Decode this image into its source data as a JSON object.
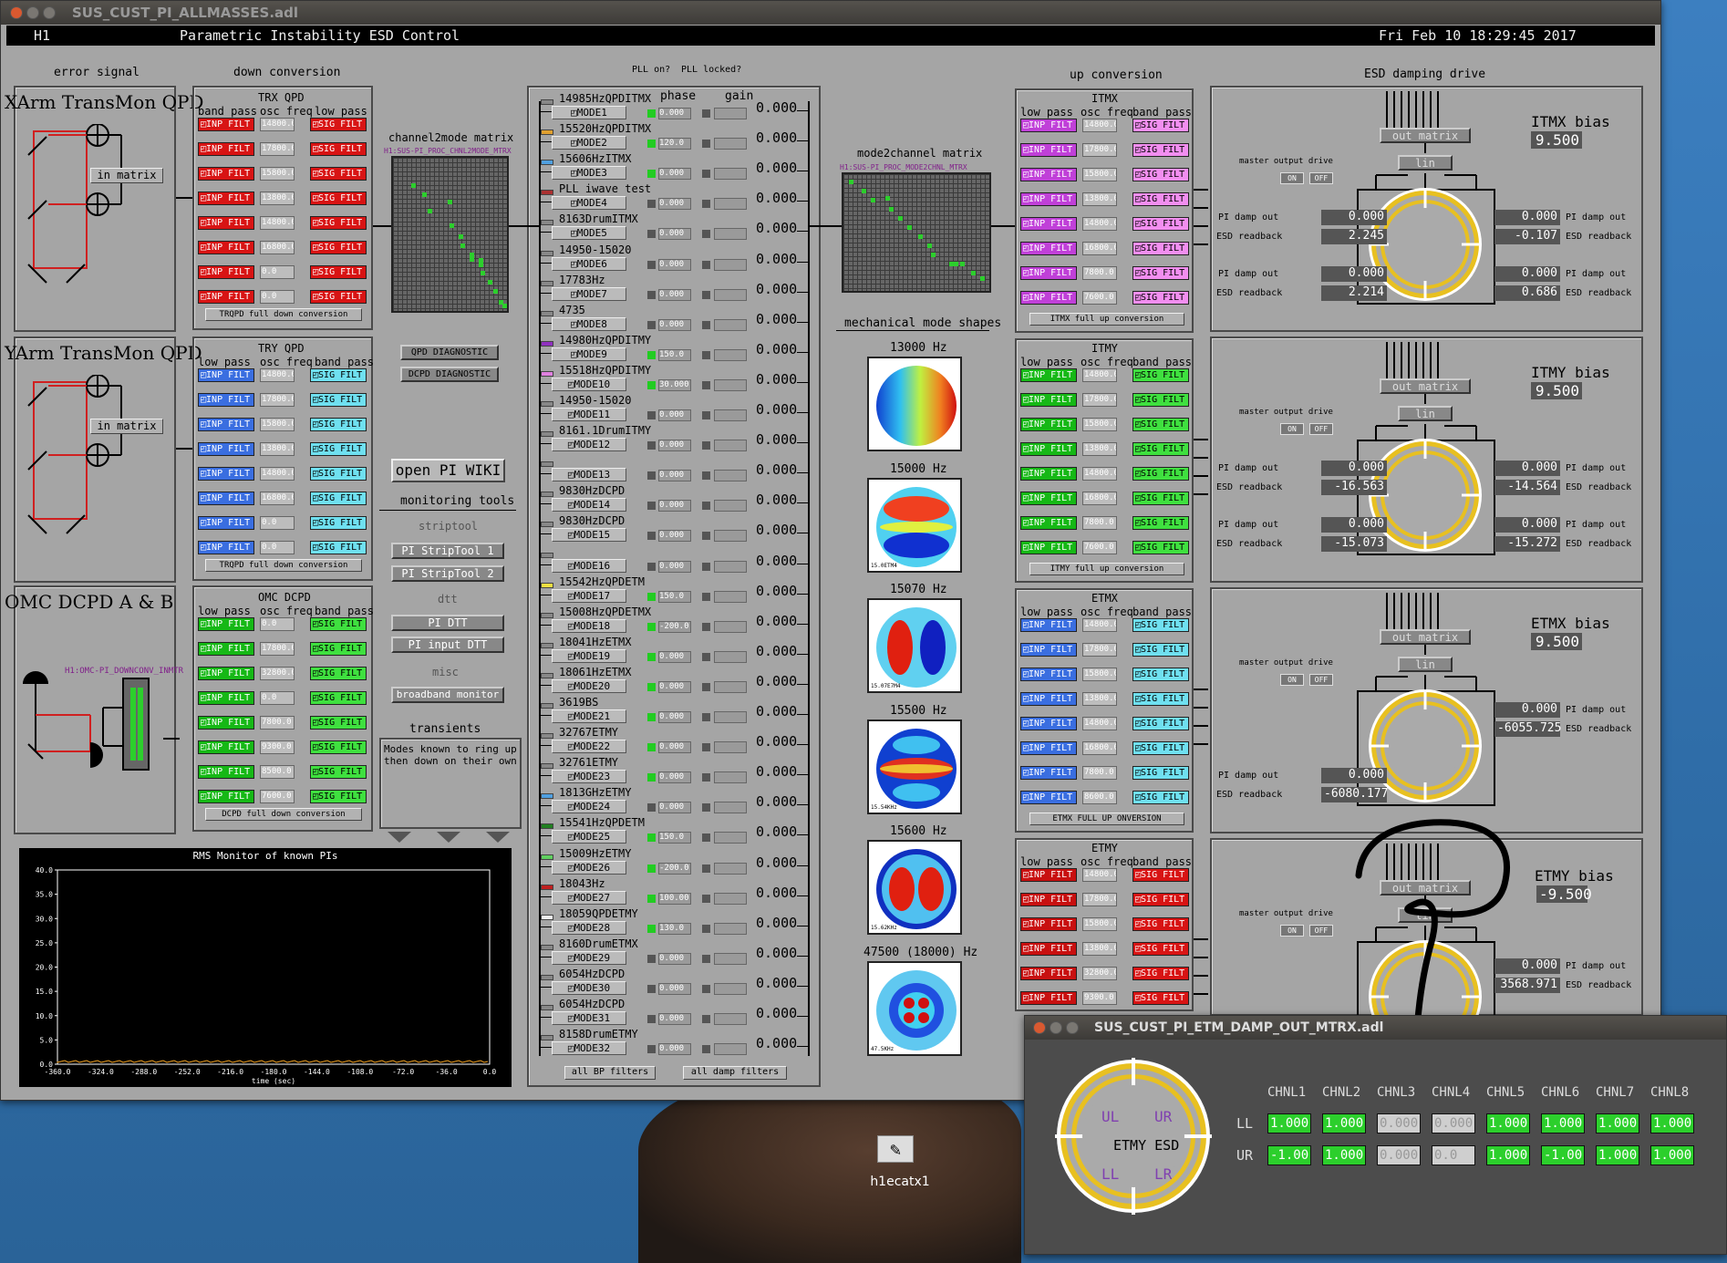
{
  "main_window": {
    "title": "SUS_CUST_PI_ALLMASSES.adl",
    "site": "H1",
    "screen_title": "Parametric Instability ESD Control",
    "datetime": "Fri Feb 10 18:29:45 2017"
  },
  "sections": {
    "error_signal": "error signal",
    "down_conversion": "down conversion",
    "up_conversion": "up conversion",
    "esd_damping": "ESD damping drive",
    "pll_on": "PLL on?",
    "pll_locked": "PLL locked?",
    "phase": "phase",
    "gain": "gain"
  },
  "error_panels": [
    {
      "title": "XArm TransMon QPD"
    },
    {
      "title": "YArm TransMon QPD"
    },
    {
      "title": "OMC DCPD A & B"
    }
  ],
  "in_matrix": "in matrix",
  "omc_channel": "H1:OMC-PI_DOWNCONV_INMTR",
  "headers": {
    "band_pass": "band pass",
    "low_pass": "low pass",
    "osc_freq": "osc freq",
    "inp_filt": "INP FILT",
    "sig_filt": "SIG FILT"
  },
  "down_panels": [
    {
      "title": "TRX QPD",
      "freqs": [
        "14800.0",
        "17800.0",
        "15800.0",
        "13800.0",
        "14800.0",
        "16800.0",
        "0.0",
        "0.0"
      ],
      "full": "TRQPD full down conversion"
    },
    {
      "title": "TRY QPD",
      "freqs": [
        "14800.0",
        "17800.0",
        "15800.0",
        "13800.0",
        "14800.0",
        "16800.0",
        "0.0",
        "0.0"
      ],
      "full": "TRQPD full down conversion"
    },
    {
      "title": "OMC DCPD",
      "freqs": [
        "0.0",
        "17800.0",
        "32800.0",
        "0.0",
        "7800.0",
        "9300.0",
        "8500.0",
        "7600.0"
      ],
      "full": "DCPD full down conversion"
    }
  ],
  "c2m": {
    "title": "channel2mode matrix",
    "channel": "H1:SUS-PI_PROC_CHNL2MODE_MTRX"
  },
  "m2c": {
    "title": "mode2channel matrix",
    "channel": "H1:SUS-PI_PROC_MODE2CHNL_MTRX"
  },
  "diag": {
    "qpd": "QPD DIAGNOSTIC",
    "dcpd": "DCPD DIAGNOSTIC"
  },
  "wiki": "open PI WIKI",
  "monitoring": {
    "title": "monitoring tools",
    "striptool": "striptool",
    "st1": "PI StripTool 1",
    "st2": "PI StripTool 2",
    "dtt": "dtt",
    "pi_dtt": "PI DTT",
    "pi_input_dtt": "PI input DTT",
    "misc": "misc",
    "broadband": "broadband monitor",
    "transients": "transients",
    "transients_text": "Modes known to ring up then down on their own"
  },
  "rms": {
    "title": "RMS Monitor of known PIs",
    "yticks": [
      "40.0",
      "35.0",
      "30.0",
      "25.0",
      "20.0",
      "15.0",
      "10.0",
      "5.0",
      "0.0"
    ],
    "xticks": [
      "-360.0",
      "-324.0",
      "-288.0",
      "-252.0",
      "-216.0",
      "-180.0",
      "-144.0",
      "-108.0",
      "-72.0",
      "-36.0",
      "0.0"
    ],
    "xlabel": "time (sec)"
  },
  "modes": [
    {
      "label": "14985HzQPDITMX",
      "name": "MODE1",
      "pll": true,
      "phase": "0.000",
      "gain": "0.000",
      "color": "#888888"
    },
    {
      "label": "15520HzQPDITMX",
      "name": "MODE2",
      "pll": true,
      "phase": "120.0",
      "gain": "0.000",
      "color": "#e0a030"
    },
    {
      "label": "15606HzITMX",
      "name": "MODE3",
      "pll": true,
      "phase": "0.000",
      "gain": "0.000",
      "color": "#50a0e0"
    },
    {
      "label": "PLL iwave test",
      "name": "MODE4",
      "pll": false,
      "phase": "0.000",
      "gain": "0.000",
      "color": "#aa3030"
    },
    {
      "label": "8163DrumITMX",
      "name": "MODE5",
      "pll": false,
      "phase": "0.000",
      "gain": "0.000",
      "color": "#888888"
    },
    {
      "label": "14950-15020",
      "name": "MODE6",
      "pll": false,
      "phase": "0.000",
      "gain": "0.000",
      "color": "#888888"
    },
    {
      "label": "17783Hz",
      "name": "MODE7",
      "pll": false,
      "phase": "0.000",
      "gain": "0.000",
      "color": "#888888"
    },
    {
      "label": "4735",
      "name": "MODE8",
      "pll": false,
      "phase": "0.000",
      "gain": "0.000",
      "color": "#888888"
    },
    {
      "label": "14980HzQPDITMY",
      "name": "MODE9",
      "pll": true,
      "phase": "150.0",
      "gain": "0.000",
      "color": "#9030c0"
    },
    {
      "label": "15518HzQPDITMY",
      "name": "MODE10",
      "pll": true,
      "phase": "30.000",
      "gain": "0.000",
      "color": "#e080e0"
    },
    {
      "label": "14950-15020",
      "name": "MODE11",
      "pll": false,
      "phase": "0.000",
      "gain": "0.000",
      "color": "#888888"
    },
    {
      "label": "8161.1DrumITMY",
      "name": "MODE12",
      "pll": false,
      "phase": "0.000",
      "gain": "0.000",
      "color": "#888888"
    },
    {
      "label": "",
      "name": "MODE13",
      "pll": false,
      "phase": "0.000",
      "gain": "0.000",
      "color": "#888888"
    },
    {
      "label": "9830HzDCPD",
      "name": "MODE14",
      "pll": false,
      "phase": "0.000",
      "gain": "0.000",
      "color": "#888888"
    },
    {
      "label": "9830HzDCPD",
      "name": "MODE15",
      "pll": false,
      "phase": "0.000",
      "gain": "0.000",
      "color": "#888888"
    },
    {
      "label": "",
      "name": "MODE16",
      "pll": false,
      "phase": "0.000",
      "gain": "0.000",
      "color": "#888888"
    },
    {
      "label": "15542HzQPDETM",
      "name": "MODE17",
      "pll": true,
      "phase": "150.0",
      "gain": "0.000",
      "color": "#f0e040"
    },
    {
      "label": "15008HzQPDETMX",
      "name": "MODE18",
      "pll": true,
      "phase": "-200.0",
      "gain": "0.000",
      "color": "#888888"
    },
    {
      "label": "18041HzETMX",
      "name": "MODE19",
      "pll": true,
      "phase": "0.000",
      "gain": "0.000",
      "color": "#888888"
    },
    {
      "label": "18061HzETMX",
      "name": "MODE20",
      "pll": true,
      "phase": "0.000",
      "gain": "0.000",
      "color": "#888888"
    },
    {
      "label": "3619BS",
      "name": "MODE21",
      "pll": true,
      "phase": "0.000",
      "gain": "0.000",
      "color": "#888888"
    },
    {
      "label": "32767ETMY",
      "name": "MODE22",
      "pll": true,
      "phase": "0.000",
      "gain": "0.000",
      "color": "#888888"
    },
    {
      "label": "32761ETMY",
      "name": "MODE23",
      "pll": true,
      "phase": "0.000",
      "gain": "0.000",
      "color": "#888888"
    },
    {
      "label": "1813GHzETMY",
      "name": "MODE24",
      "pll": false,
      "phase": "0.000",
      "gain": "0.000",
      "color": "#50a0e0"
    },
    {
      "label": "15541HzQPDETM",
      "name": "MODE25",
      "pll": true,
      "phase": "150.0",
      "gain": "0.000",
      "color": "#208020"
    },
    {
      "label": "15009HzETMY",
      "name": "MODE26",
      "pll": true,
      "phase": "-200.0",
      "gain": "0.000",
      "color": "#60d060"
    },
    {
      "label": "18043Hz",
      "name": "MODE27",
      "pll": true,
      "phase": "100.00",
      "gain": "0.000",
      "color": "#c02020"
    },
    {
      "label": "18059QPDETMY",
      "name": "MODE28",
      "pll": true,
      "phase": "130.0",
      "gain": "0.000",
      "color": "#f0f0f0"
    },
    {
      "label": "8160DrumETMX",
      "name": "MODE29",
      "pll": false,
      "phase": "0.000",
      "gain": "0.000",
      "color": "#888888"
    },
    {
      "label": "6054HzDCPD",
      "name": "MODE30",
      "pll": false,
      "phase": "0.000",
      "gain": "0.000",
      "color": "#888888"
    },
    {
      "label": "6054HzDCPD",
      "name": "MODE31",
      "pll": false,
      "phase": "0.000",
      "gain": "0.000",
      "color": "#888888"
    },
    {
      "label": "8158DrumETMY",
      "name": "MODE32",
      "pll": false,
      "phase": "0.000",
      "gain": "0.000",
      "color": "#888888"
    }
  ],
  "all_bp": "all BP filters",
  "all_damp": "all damp filters",
  "shapes": {
    "title": "mechanical mode shapes",
    "items": [
      {
        "freq": "13000 Hz",
        "cap": ""
      },
      {
        "freq": "15000 Hz",
        "cap": "15.0ETM4"
      },
      {
        "freq": "15070 Hz",
        "cap": "15.07E7M4"
      },
      {
        "freq": "15500 Hz",
        "cap": "15.54KHz"
      },
      {
        "freq": "15600 Hz",
        "cap": "15.62KHz"
      },
      {
        "freq": "47500 (18000) Hz",
        "cap": "47.5KHz"
      }
    ]
  },
  "up_panels": [
    {
      "title": "ITMX",
      "freqs": [
        "14800.0",
        "17800.0",
        "15800.0",
        "13800.0",
        "14800.0",
        "16800.0",
        "7800.0",
        "7600.0"
      ],
      "full": "ITMX full up conversion"
    },
    {
      "title": "ITMY",
      "freqs": [
        "14800.0",
        "17800.0",
        "15800.0",
        "13800.0",
        "14800.0",
        "16800.0",
        "7800.0",
        "7600.0"
      ],
      "full": "ITMY full up conversion"
    },
    {
      "title": "ETMX",
      "freqs": [
        "14800.0",
        "17800.0",
        "15800.0",
        "13800.0",
        "14800.0",
        "16800.0",
        "7800.0",
        "8600.0"
      ],
      "full": "ETMX FULL UP ONVERSION"
    },
    {
      "title": "ETMY",
      "freqs": [
        "14800.0",
        "17800.0",
        "15800.0",
        "13800.0",
        "32800.0",
        "9300.0"
      ],
      "full": ""
    }
  ],
  "esd": {
    "out_matrix": "out matrix",
    "lin": "lin",
    "master": "master output drive",
    "on": "ON",
    "off": "OFF",
    "pi_damp_out": "PI damp out",
    "esd_readback": "ESD readback",
    "panels": [
      {
        "bias_label": "ITMX bias",
        "bias": "9.500",
        "l1": "0.000",
        "l2": "2.245",
        "l3": "0.000",
        "l4": "2.214",
        "r1": "0.000",
        "r2": "-0.107",
        "r3": "0.000",
        "r4": "0.686"
      },
      {
        "bias_label": "ITMY bias",
        "bias": "9.500",
        "l1": "0.000",
        "l2": "-16.563",
        "l3": "0.000",
        "l4": "-15.073",
        "r1": "0.000",
        "r2": "-14.564",
        "r3": "0.000",
        "r4": "-15.272"
      },
      {
        "bias_label": "ETMX bias",
        "bias": "9.500",
        "l3": "0.000",
        "l4": "-6080.177",
        "r1": "0.000",
        "r2": "-6055.725"
      },
      {
        "bias_label": "ETMY bias",
        "bias": "-9.500",
        "r1": "0.000",
        "r2": "3568.971"
      }
    ]
  },
  "popup": {
    "title": "SUS_CUST_PI_ETM_DAMP_OUT_MTRX.adl",
    "esd_label": "ETMY ESD",
    "quad": {
      "ul": "UL",
      "ur": "UR",
      "ll": "LL",
      "lr": "LR"
    },
    "cols": [
      "CHNL1",
      "CHNL2",
      "CHNL3",
      "CHNL4",
      "CHNL5",
      "CHNL6",
      "CHNL7",
      "CHNL8"
    ],
    "rows": [
      {
        "label": "LL",
        "values": [
          "1.000",
          "1.000",
          "0.000",
          "0.000",
          "1.000",
          "1.000",
          "1.000",
          "1.000"
        ]
      },
      {
        "label": "UR",
        "values": [
          "-1.00",
          "1.000",
          "0.000",
          "0.0",
          "1.000",
          "-1.00",
          "1.000",
          "1.000"
        ]
      }
    ]
  },
  "desktop": {
    "icon_label": "h1ecatx1"
  },
  "colors": {
    "accent": "#22cc22",
    "desktop": "#3a7ab8",
    "panel": "#a5a5a5",
    "gold": "#e8c020"
  }
}
